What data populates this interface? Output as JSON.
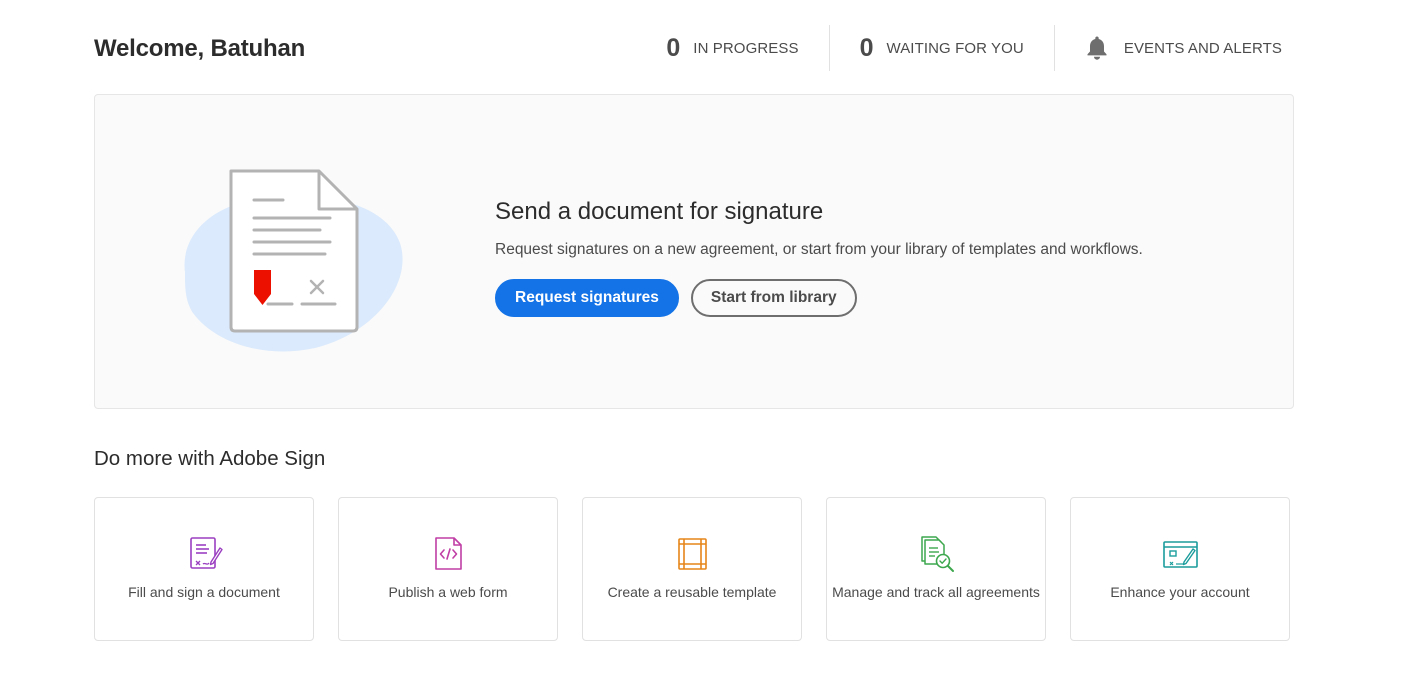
{
  "header": {
    "welcome": "Welcome, Batuhan",
    "stats": [
      {
        "count": "0",
        "label": "IN PROGRESS"
      },
      {
        "count": "0",
        "label": "WAITING FOR YOU"
      }
    ],
    "alerts_label": "EVENTS AND ALERTS",
    "alerts_icon": "bell-icon"
  },
  "hero": {
    "title": "Send a document for signature",
    "description": "Request signatures on a new agreement, or start from your library of templates and workflows.",
    "primary_button": "Request signatures",
    "secondary_button": "Start from library",
    "illustration": "document-signature-illustration"
  },
  "section": {
    "title": "Do more with Adobe Sign"
  },
  "cards": [
    {
      "label": "Fill and sign a document",
      "icon": "fill-sign-icon",
      "color": "#9b3fc1"
    },
    {
      "label": "Publish a web form",
      "icon": "web-form-icon",
      "color": "#c03ea5"
    },
    {
      "label": "Create a reusable template",
      "icon": "template-icon",
      "color": "#e68619"
    },
    {
      "label": "Manage and track all agreements",
      "icon": "manage-agreements-icon",
      "color": "#3da74e"
    },
    {
      "label": "Enhance your account",
      "icon": "enhance-account-icon",
      "color": "#1b9c9c"
    }
  ],
  "colors": {
    "accent": "#1473e6",
    "background": "#ffffff",
    "panel": "#fafafa"
  }
}
